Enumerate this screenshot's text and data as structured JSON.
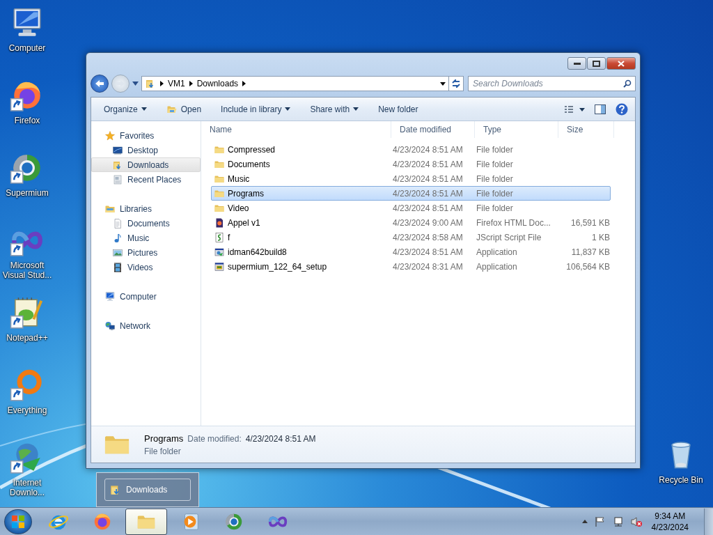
{
  "desktop_icons": [
    {
      "label": "Computer",
      "kind": "computer",
      "shortcut": false
    },
    {
      "label": "Firefox",
      "kind": "firefox",
      "shortcut": true
    },
    {
      "label": "Supermium",
      "kind": "supermium",
      "shortcut": true
    },
    {
      "label": "Microsoft Visual Stud...",
      "kind": "vs",
      "shortcut": true
    },
    {
      "label": "Notepad++",
      "kind": "notepad",
      "shortcut": true
    },
    {
      "label": "Everything",
      "kind": "everything",
      "shortcut": true
    },
    {
      "label": "Internet Downlo...",
      "kind": "idm",
      "shortcut": true
    }
  ],
  "recycle_bin": {
    "label": "Recycle Bin"
  },
  "window": {
    "breadcrumb": [
      "VM1",
      "Downloads"
    ],
    "search": {
      "placeholder": "Search Downloads"
    },
    "toolbar": [
      {
        "label": "Organize",
        "dropdown": true,
        "kind": "plain"
      },
      {
        "label": "Open",
        "dropdown": false,
        "kind": "open"
      },
      {
        "label": "Include in library",
        "dropdown": true,
        "kind": "plain"
      },
      {
        "label": "Share with",
        "dropdown": true,
        "kind": "plain"
      },
      {
        "label": "New folder",
        "dropdown": false,
        "kind": "plain"
      }
    ],
    "nav": [
      {
        "label": "Favorites",
        "kind": "star",
        "selected": false,
        "children": [
          {
            "label": "Desktop",
            "kind": "desktop",
            "selected": false
          },
          {
            "label": "Downloads",
            "kind": "downloads",
            "selected": true
          },
          {
            "label": "Recent Places",
            "kind": "recent",
            "selected": false
          }
        ]
      },
      {
        "label": "Libraries",
        "kind": "library",
        "selected": false,
        "children": [
          {
            "label": "Documents",
            "kind": "document",
            "selected": false
          },
          {
            "label": "Music",
            "kind": "music",
            "selected": false
          },
          {
            "label": "Pictures",
            "kind": "pictures",
            "selected": false
          },
          {
            "label": "Videos",
            "kind": "videos",
            "selected": false
          }
        ]
      },
      {
        "label": "Computer",
        "kind": "computer",
        "selected": false
      },
      {
        "label": "Network",
        "kind": "network",
        "selected": false
      }
    ],
    "columns": [
      "Name",
      "Date modified",
      "Type",
      "Size"
    ],
    "rows": [
      {
        "name": "Compressed",
        "date": "4/23/2024 8:51 AM",
        "type": "File folder",
        "kind": "folder",
        "selected": false
      },
      {
        "name": "Documents",
        "date": "4/23/2024 8:51 AM",
        "type": "File folder",
        "kind": "folder",
        "selected": false
      },
      {
        "name": "Music",
        "date": "4/23/2024 8:51 AM",
        "type": "File folder",
        "kind": "folder",
        "selected": false
      },
      {
        "name": "Programs",
        "date": "4/23/2024 8:51 AM",
        "type": "File folder",
        "kind": "folder",
        "selected": true
      },
      {
        "name": "Video",
        "date": "4/23/2024 8:51 AM",
        "type": "File folder",
        "kind": "folder",
        "selected": false
      },
      {
        "name": "Appel v1",
        "date": "4/23/2024 9:00 AM",
        "type": "Firefox HTML Doc...",
        "size": "16,591 KB",
        "kind": "html",
        "selected": false
      },
      {
        "name": "f",
        "date": "4/23/2024 8:58 AM",
        "type": "JScript Script File",
        "size": "1 KB",
        "kind": "script",
        "selected": false
      },
      {
        "name": "idman642build8",
        "date": "4/23/2024 8:51 AM",
        "type": "Application",
        "size": "11,837 KB",
        "kind": "app",
        "selected": false
      },
      {
        "name": "supermium_122_64_setup",
        "date": "4/23/2024 8:31 AM",
        "type": "Application",
        "size": "106,564 KB",
        "kind": "setup",
        "selected": false
      }
    ],
    "details": {
      "name": "Programs",
      "date_label": "Date modified:",
      "date": "4/23/2024 8:51 AM",
      "type": "File folder"
    }
  },
  "preview": {
    "label": "Downloads"
  },
  "taskbar": {
    "apps": [
      {
        "kind": "ie",
        "selected": false
      },
      {
        "kind": "firefox",
        "selected": false
      },
      {
        "kind": "explorer",
        "selected": true
      },
      {
        "kind": "media",
        "selected": false
      },
      {
        "kind": "supermium",
        "selected": false
      },
      {
        "kind": "vs",
        "selected": false
      }
    ],
    "clock": {
      "time": "9:34 AM",
      "date": "4/23/2024"
    }
  }
}
